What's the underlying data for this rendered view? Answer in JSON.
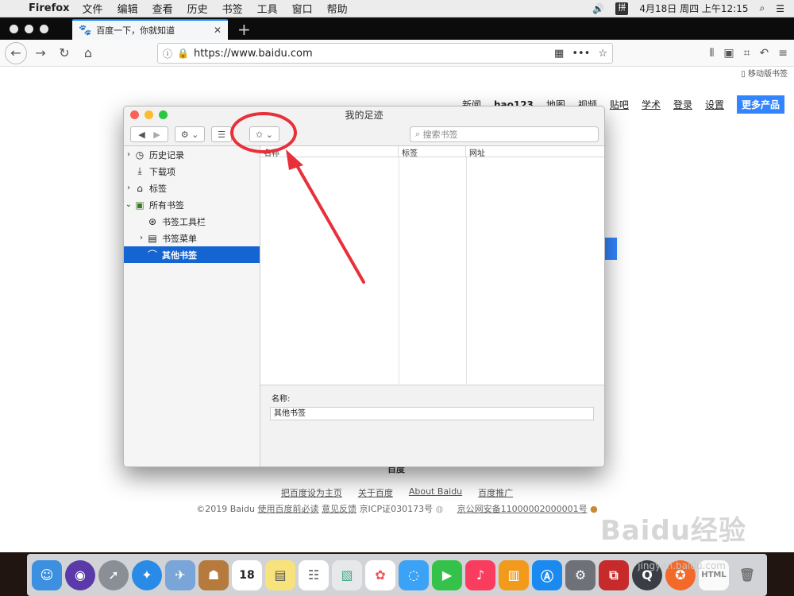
{
  "menubar": {
    "app": "Firefox",
    "items": [
      "文件",
      "编辑",
      "查看",
      "历史",
      "书签",
      "工具",
      "窗口",
      "帮助"
    ],
    "ime": "拼",
    "clock": "4月18日 周四 上午12:15"
  },
  "browser": {
    "tab_title": "百度一下，你就知道",
    "url": "https://www.baidu.com",
    "mobile_bookmarks": "移动版书签"
  },
  "baidu": {
    "nav": [
      "新闻",
      "hao123",
      "地图",
      "视频",
      "贴吧",
      "学术",
      "登录",
      "设置"
    ],
    "more_products": "更多产品",
    "hidden_logo_text": "百度",
    "footer_links": [
      "把百度设为主页",
      "关于百度",
      "About  Baidu",
      "百度推广"
    ],
    "footer_copyright": "©2019 Baidu",
    "footer_terms": "使用百度前必读",
    "footer_feedback": "意见反馈",
    "footer_icp": "京ICP证030173号",
    "footer_police": "京公网安备11000002000001号"
  },
  "library": {
    "title": "我的足迹",
    "search_placeholder": "搜索书签",
    "tree": [
      {
        "label": "历史记录",
        "icon": "clock-icon"
      },
      {
        "label": "下载项",
        "icon": "download-icon"
      },
      {
        "label": "标签",
        "icon": "tag-icon"
      },
      {
        "label": "所有书签",
        "icon": "bookmarks-icon"
      },
      {
        "label": "书签工具栏",
        "icon": "star-folder-icon"
      },
      {
        "label": "书签菜单",
        "icon": "menu-folder-icon"
      },
      {
        "label": "其他书签",
        "icon": "folder-icon"
      }
    ],
    "columns": [
      "名称",
      "标签",
      "网址"
    ],
    "detail_name_label": "名称:",
    "detail_name_value": "其他书签"
  },
  "watermark": {
    "brand": "Baidu经验",
    "site": "jingyan.baidu.com"
  }
}
